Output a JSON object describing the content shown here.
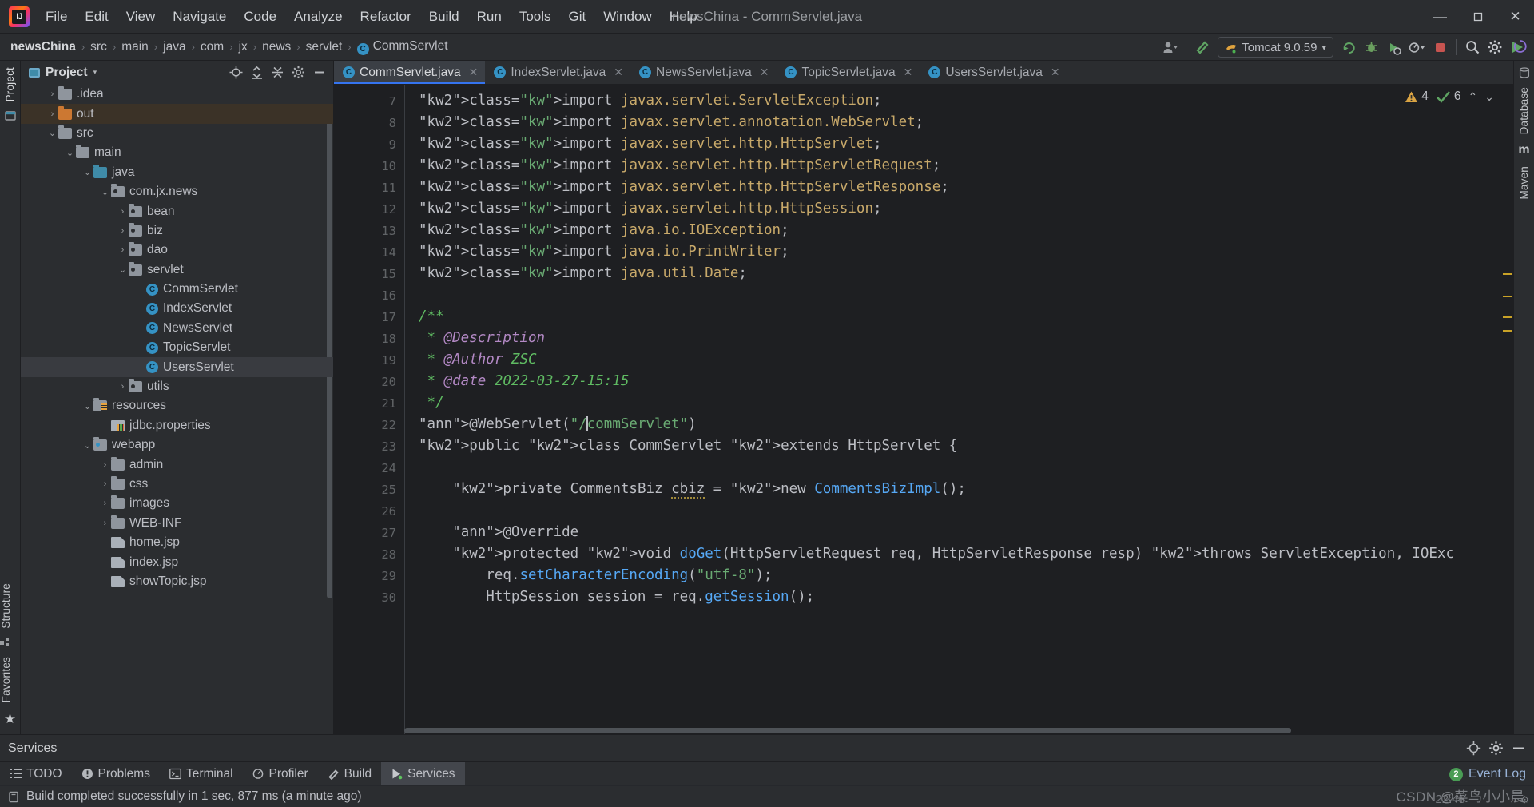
{
  "window": {
    "title": "newsChina - CommServlet.java",
    "logo_alt": "intellij-idea-logo",
    "minimize": "—",
    "maximize": "❐",
    "close": "✕"
  },
  "menu": [
    {
      "label": "File"
    },
    {
      "label": "Edit"
    },
    {
      "label": "View"
    },
    {
      "label": "Navigate"
    },
    {
      "label": "Code"
    },
    {
      "label": "Analyze"
    },
    {
      "label": "Refactor"
    },
    {
      "label": "Build"
    },
    {
      "label": "Run"
    },
    {
      "label": "Tools"
    },
    {
      "label": "Git"
    },
    {
      "label": "Window"
    },
    {
      "label": "Help"
    }
  ],
  "breadcrumbs": [
    {
      "label": "newsChina"
    },
    {
      "label": "src"
    },
    {
      "label": "main"
    },
    {
      "label": "java"
    },
    {
      "label": "com"
    },
    {
      "label": "jx"
    },
    {
      "label": "news"
    },
    {
      "label": "servlet"
    },
    {
      "label": "CommServlet"
    }
  ],
  "breadcrumb_separator": "›",
  "toolbar": {
    "account_icon": "user-account-icon",
    "build_icon": "build-hammer-icon",
    "run_config": "Tomcat 9.0.59",
    "run_config_caret": "▾",
    "update_icon": "update-project-icon",
    "debug_icon": "debug-icon",
    "coverage_icon": "run-with-coverage-icon",
    "profile_icon": "profiler-icon",
    "stop_icon": "stop-icon",
    "search_icon": "search-everywhere-icon",
    "settings_icon": "settings-gear-icon",
    "run_icon": "run-green-arrow-icon"
  },
  "left_rail": {
    "top": [
      "Project"
    ],
    "icons": [
      "database-rail-icon"
    ],
    "bottom": [
      "Structure",
      "Favorites"
    ]
  },
  "right_rail": {
    "items": [
      "Database",
      "Maven"
    ]
  },
  "project_panel": {
    "title": "Project",
    "caret": "▾",
    "actions": [
      "locate-file-icon",
      "expand-all-icon",
      "collapse-all-icon",
      "settings-gear-icon",
      "hide-panel-icon"
    ],
    "tree": [
      {
        "label": ".idea",
        "depth": 1,
        "arrow": "›",
        "icon": "folder-grey",
        "state": "normal"
      },
      {
        "label": "out",
        "depth": 1,
        "arrow": "›",
        "icon": "folder-orange",
        "state": "sel-out"
      },
      {
        "label": "src",
        "depth": 1,
        "arrow": "⌄",
        "icon": "folder-grey",
        "state": "normal"
      },
      {
        "label": "main",
        "depth": 2,
        "arrow": "⌄",
        "icon": "folder-grey",
        "state": "normal"
      },
      {
        "label": "java",
        "depth": 3,
        "arrow": "⌄",
        "icon": "folder-teal",
        "state": "normal"
      },
      {
        "label": "com.jx.news",
        "depth": 4,
        "arrow": "⌄",
        "icon": "folder-package",
        "state": "normal"
      },
      {
        "label": "bean",
        "depth": 5,
        "arrow": "›",
        "icon": "folder-package",
        "state": "normal"
      },
      {
        "label": "biz",
        "depth": 5,
        "arrow": "›",
        "icon": "folder-package",
        "state": "normal"
      },
      {
        "label": "dao",
        "depth": 5,
        "arrow": "›",
        "icon": "folder-package",
        "state": "normal"
      },
      {
        "label": "servlet",
        "depth": 5,
        "arrow": "⌄",
        "icon": "folder-package",
        "state": "normal"
      },
      {
        "label": "CommServlet",
        "depth": 6,
        "arrow": "",
        "icon": "java-class",
        "state": "normal"
      },
      {
        "label": "IndexServlet",
        "depth": 6,
        "arrow": "",
        "icon": "java-class",
        "state": "normal"
      },
      {
        "label": "NewsServlet",
        "depth": 6,
        "arrow": "",
        "icon": "java-class",
        "state": "normal"
      },
      {
        "label": "TopicServlet",
        "depth": 6,
        "arrow": "",
        "icon": "java-class",
        "state": "normal"
      },
      {
        "label": "UsersServlet",
        "depth": 6,
        "arrow": "",
        "icon": "java-class",
        "state": "sel-grey"
      },
      {
        "label": "utils",
        "depth": 5,
        "arrow": "›",
        "icon": "folder-package",
        "state": "normal"
      },
      {
        "label": "resources",
        "depth": 3,
        "arrow": "⌄",
        "icon": "folder-resources",
        "state": "normal"
      },
      {
        "label": "jdbc.properties",
        "depth": 4,
        "arrow": "",
        "icon": "properties-file",
        "state": "normal"
      },
      {
        "label": "webapp",
        "depth": 3,
        "arrow": "⌄",
        "icon": "folder-webapp",
        "state": "normal"
      },
      {
        "label": "admin",
        "depth": 4,
        "arrow": "›",
        "icon": "folder-grey",
        "state": "normal"
      },
      {
        "label": "css",
        "depth": 4,
        "arrow": "›",
        "icon": "folder-grey",
        "state": "normal"
      },
      {
        "label": "images",
        "depth": 4,
        "arrow": "›",
        "icon": "folder-grey",
        "state": "normal"
      },
      {
        "label": "WEB-INF",
        "depth": 4,
        "arrow": "›",
        "icon": "folder-grey",
        "state": "normal"
      },
      {
        "label": "home.jsp",
        "depth": 4,
        "arrow": "",
        "icon": "jsp-file",
        "state": "normal"
      },
      {
        "label": "index.jsp",
        "depth": 4,
        "arrow": "",
        "icon": "jsp-file",
        "state": "normal"
      },
      {
        "label": "showTopic.jsp",
        "depth": 4,
        "arrow": "",
        "icon": "jsp-file",
        "state": "normal"
      }
    ]
  },
  "editor": {
    "tabs": [
      {
        "label": "CommServlet.java",
        "icon": "java-class",
        "active": true,
        "close": "✕"
      },
      {
        "label": "IndexServlet.java",
        "icon": "java-class",
        "active": false,
        "close": "✕"
      },
      {
        "label": "NewsServlet.java",
        "icon": "java-class",
        "active": false,
        "close": "✕"
      },
      {
        "label": "TopicServlet.java",
        "icon": "java-class",
        "active": false,
        "close": "✕"
      },
      {
        "label": "UsersServlet.java",
        "icon": "java-class",
        "active": false,
        "close": "✕"
      }
    ],
    "inspections": {
      "warning_icon": "warning-triangle-icon",
      "warning_count": "4",
      "check_icon": "inspection-ok-icon",
      "check_count": "6",
      "prev_icon": "⌃",
      "next_icon": "⌄"
    },
    "first_line": 7,
    "lines": [
      {
        "n": 7,
        "text": "import javax.servlet.ServletException;"
      },
      {
        "n": 8,
        "text": "import javax.servlet.annotation.WebServlet;"
      },
      {
        "n": 9,
        "text": "import javax.servlet.http.HttpServlet;"
      },
      {
        "n": 10,
        "text": "import javax.servlet.http.HttpServletRequest;"
      },
      {
        "n": 11,
        "text": "import javax.servlet.http.HttpServletResponse;"
      },
      {
        "n": 12,
        "text": "import javax.servlet.http.HttpSession;"
      },
      {
        "n": 13,
        "text": "import java.io.IOException;"
      },
      {
        "n": 14,
        "text": "import java.io.PrintWriter;"
      },
      {
        "n": 15,
        "text": "import java.util.Date;"
      },
      {
        "n": 16,
        "text": ""
      },
      {
        "n": 17,
        "text": "/**"
      },
      {
        "n": 18,
        "text": " * @Description"
      },
      {
        "n": 19,
        "text": " * @Author ZSC"
      },
      {
        "n": 20,
        "text": " * @date 2022-03-27-15:15"
      },
      {
        "n": 21,
        "text": " */"
      },
      {
        "n": 22,
        "text": "@WebServlet(\"/commServlet\")"
      },
      {
        "n": 23,
        "text": "public class CommServlet extends HttpServlet {"
      },
      {
        "n": 24,
        "text": ""
      },
      {
        "n": 25,
        "text": "    private CommentsBiz cbiz = new CommentsBizImpl();"
      },
      {
        "n": 26,
        "text": ""
      },
      {
        "n": 27,
        "text": "    @Override"
      },
      {
        "n": 28,
        "text": "    protected void doGet(HttpServletRequest req, HttpServletResponse resp) throws ServletException, IOExc"
      },
      {
        "n": 29,
        "text": "        req.setCharacterEncoding(\"utf-8\");"
      },
      {
        "n": 30,
        "text": "        HttpSession session = req.getSession();"
      }
    ]
  },
  "services_panel": {
    "title": "Services",
    "actions": [
      "locate-icon",
      "settings-gear-icon",
      "hide-panel-icon"
    ]
  },
  "tool_windows": [
    {
      "label": "TODO",
      "icon": "todo-list-icon",
      "active": false
    },
    {
      "label": "Problems",
      "icon": "problems-warning-icon",
      "active": false
    },
    {
      "label": "Terminal",
      "icon": "terminal-icon",
      "active": false
    },
    {
      "label": "Profiler",
      "icon": "profiler-icon",
      "active": false
    },
    {
      "label": "Build",
      "icon": "build-hammer-icon",
      "active": false
    },
    {
      "label": "Services",
      "icon": "services-play-icon",
      "active": true
    }
  ],
  "event_log": {
    "count": "2",
    "label": "Event Log"
  },
  "status": {
    "icon": "build-status-icon",
    "text": "Build completed successfully in 1 sec, 877 ms (a minute ago)"
  },
  "watermark": {
    "text": "CSDN @菜鸟小小晨",
    "sub": "22:45"
  },
  "colors": {
    "accent_blue": "#3574f0",
    "class_icon": "#3592c4",
    "folder_orange": "#cc7832",
    "green_run": "#499c54",
    "warning": "#c9a227"
  }
}
